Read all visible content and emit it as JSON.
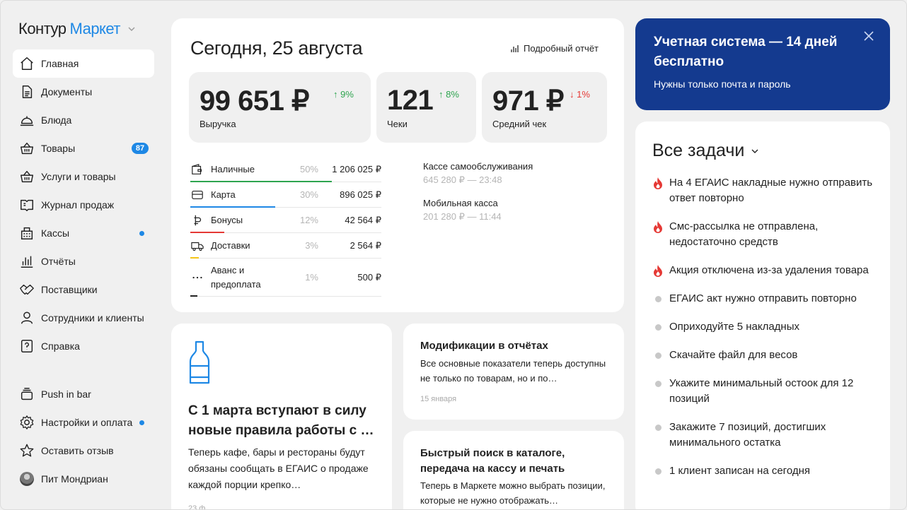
{
  "brand": {
    "part1": "Контур",
    "part2": "Маркет"
  },
  "nav": [
    {
      "label": "Главная",
      "icon": "home-icon",
      "active": true
    },
    {
      "label": "Документы",
      "icon": "document-icon"
    },
    {
      "label": "Блюда",
      "icon": "cloche-icon"
    },
    {
      "label": "Товары",
      "icon": "basket-icon",
      "badge": "87"
    },
    {
      "label": "Услуги и товары",
      "icon": "basket-icon"
    },
    {
      "label": "Журнал продаж",
      "icon": "book-icon"
    },
    {
      "label": "Кассы",
      "icon": "cash-register-icon",
      "dot": true
    },
    {
      "label": "Отчёты",
      "icon": "bar-chart-icon"
    },
    {
      "label": "Поставщики",
      "icon": "handshake-icon"
    },
    {
      "label": "Сотрудники и клиенты",
      "icon": "user-icon"
    },
    {
      "label": "Справка",
      "icon": "help-icon"
    }
  ],
  "nav_bottom": [
    {
      "label": "Push in bar",
      "icon": "stack-icon"
    },
    {
      "label": "Настройки и оплата",
      "icon": "gear-icon",
      "dot": true
    },
    {
      "label": "Оставить отзыв",
      "icon": "star-icon"
    },
    {
      "label": "Пит Мондриан",
      "icon": "avatar"
    }
  ],
  "today": {
    "title": "Сегодня, 25 августа",
    "report_link": "Подробный отчёт",
    "stats": [
      {
        "value": "99 651 ₽",
        "label": "Выручка",
        "change": "9%",
        "direction": "up"
      },
      {
        "value": "121",
        "label": "Чеки",
        "change": "8%",
        "direction": "up"
      },
      {
        "value": "971 ₽",
        "label": "Средний чек",
        "change": "1%",
        "direction": "down"
      }
    ],
    "payments": [
      {
        "name": "Наличные",
        "percent": "50%",
        "share": 0.5,
        "sum": "1 206 025 ₽",
        "color": "#2ea44f",
        "icon": "wallet-icon"
      },
      {
        "name": "Карта",
        "percent": "30%",
        "share": 0.3,
        "sum": "896 025 ₽",
        "color": "#1e88e5",
        "icon": "card-icon"
      },
      {
        "name": "Бонусы",
        "percent": "12%",
        "share": 0.12,
        "sum": "42 564 ₽",
        "color": "#e53935",
        "icon": "bonus-icon"
      },
      {
        "name": "Доставки",
        "percent": "3%",
        "share": 0.03,
        "sum": "2 564 ₽",
        "color": "#f5c518",
        "icon": "truck-icon"
      },
      {
        "name": "Аванс и предоплата",
        "percent": "1%",
        "share": 0.01,
        "sum": "500 ₽",
        "color": "#222222",
        "icon": "more-icon"
      }
    ],
    "kassas": [
      {
        "name": "Кассе самообслуживания",
        "detail": "645 280 ₽ — 23:48"
      },
      {
        "name": "Мобильная касса",
        "detail": "201 280 ₽ — 11:44"
      }
    ]
  },
  "news": [
    {
      "title": "С 1 марта вступают в силу новые правила работы с …",
      "text": "Теперь кафе, бары и рестораны будут обязаны сообщать в ЕГАИС о продаже каждой порции крепко…",
      "date": "23 ф"
    },
    {
      "title": "Модификации в отчётах",
      "text": "Все основные показатели теперь доступны не только по товарам, но и по…",
      "date": "15 января"
    },
    {
      "title": "Быстрый поиск в каталоге, передача на кассу и печать",
      "text": "Теперь в Маркете можно выбрать позиции, которые не нужно отображать…"
    }
  ],
  "promo": {
    "title": "Учетная система — 14 дней бесплатно",
    "subtitle": "Нужны только почта и пароль"
  },
  "tasks": {
    "title": "Все задачи",
    "items": [
      {
        "text": "На 4 ЕГАИС накладные нужно отправить ответ повторно",
        "urgent": true
      },
      {
        "text": "Смс-рассылка не отправлена, недостаточно средств",
        "urgent": true
      },
      {
        "text": "Акция отключена из-за удаления товара",
        "urgent": true
      },
      {
        "text": "ЕГАИС акт нужно отправить повторно",
        "urgent": false
      },
      {
        "text": "Оприходуйте 5 накладных",
        "urgent": false
      },
      {
        "text": "Скачайте файл для весов",
        "urgent": false
      },
      {
        "text": "Укажите минимальный остоок для 12 позиций",
        "urgent": false
      },
      {
        "text": "Закажите 7 позиций, достигших минимального остатка",
        "urgent": false
      },
      {
        "text": "1 клиент записан на сегодня",
        "urgent": false
      }
    ]
  },
  "colors": {
    "accent": "#1e88e5",
    "promo_bg": "#143a8f",
    "up": "#2ea44f",
    "down": "#e53935"
  }
}
